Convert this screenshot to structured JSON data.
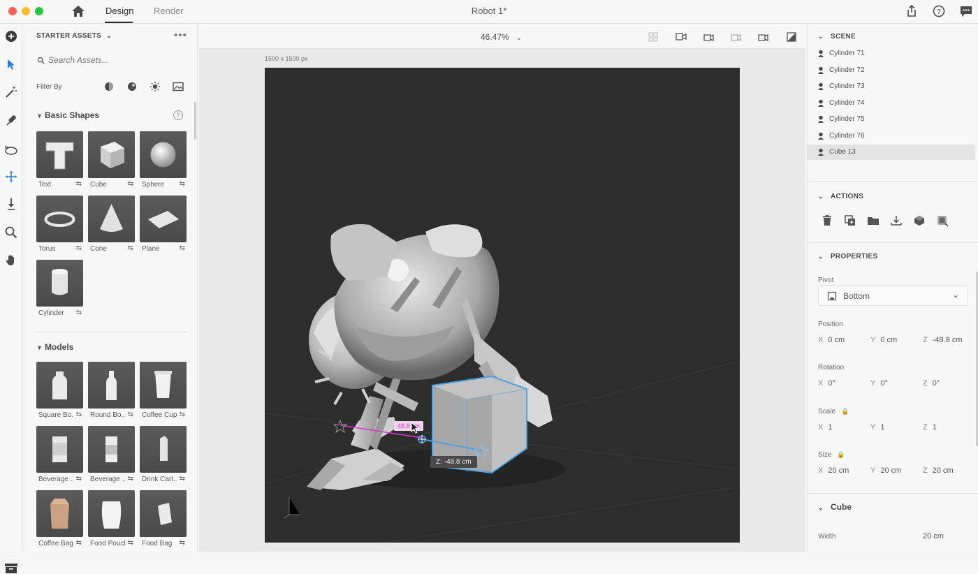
{
  "app": {
    "tabs": [
      "Design",
      "Render"
    ],
    "active_tab": "Design",
    "document_title": "Robot 1*"
  },
  "left_panel": {
    "header": "STARTER ASSETS",
    "search_placeholder": "Search Assets...",
    "filter_label": "Filter By",
    "basic_shapes": {
      "title": "Basic Shapes",
      "items": [
        {
          "label": "Text"
        },
        {
          "label": "Cube"
        },
        {
          "label": "Sphere"
        },
        {
          "label": "Torus"
        },
        {
          "label": "Cone"
        },
        {
          "label": "Plane"
        },
        {
          "label": "Cylinder"
        }
      ]
    },
    "models": {
      "title": "Models",
      "items": [
        {
          "label": "Square Bo..."
        },
        {
          "label": "Round Bo..."
        },
        {
          "label": "Coffee Cup"
        },
        {
          "label": "Beverage ..."
        },
        {
          "label": "Beverage ..."
        },
        {
          "label": "Drink Cart..."
        },
        {
          "label": "Coffee Bag"
        },
        {
          "label": "Food Pouch"
        },
        {
          "label": "Food Bag"
        }
      ]
    }
  },
  "canvas": {
    "zoom": "46.47%",
    "size_label": "1500 x 1500 px",
    "measure_label_1": "48.8 cm",
    "measure_label_2": "Z: -48.8 cm"
  },
  "scene": {
    "title": "SCENE",
    "items": [
      {
        "label": "Cylinder 71"
      },
      {
        "label": "Cylinder 72"
      },
      {
        "label": "Cylinder 73"
      },
      {
        "label": "Cylinder 74"
      },
      {
        "label": "Cylinder 75"
      },
      {
        "label": "Cylinder 76"
      },
      {
        "label": "Cube 13",
        "selected": true
      }
    ]
  },
  "actions": {
    "title": "ACTIONS",
    "icons": [
      "trash-icon",
      "duplicate-icon",
      "group-folder-icon",
      "drop-to-ground-icon",
      "material-icon",
      "edit-object-icon"
    ]
  },
  "properties": {
    "title": "PROPERTIES",
    "pivot_label": "Pivot",
    "pivot_value": "Bottom",
    "position": {
      "label": "Position",
      "x": "0 cm",
      "y": "0 cm",
      "z": "-48.8 cm"
    },
    "rotation": {
      "label": "Rotation",
      "x": "0°",
      "y": "0°",
      "z": "0°"
    },
    "scale": {
      "label": "Scale",
      "x": "1",
      "y": "1",
      "z": "1"
    },
    "size": {
      "label": "Size",
      "x": "20 cm",
      "y": "20 cm",
      "z": "20 cm"
    }
  },
  "cube_section": {
    "title": "Cube",
    "width_label": "Width",
    "width_value": "20 cm"
  },
  "colors": {
    "selection_blue": "#4aa3e6",
    "measure_magenta": "#d43bd0",
    "viewport_bg": "#2d2d2d"
  }
}
